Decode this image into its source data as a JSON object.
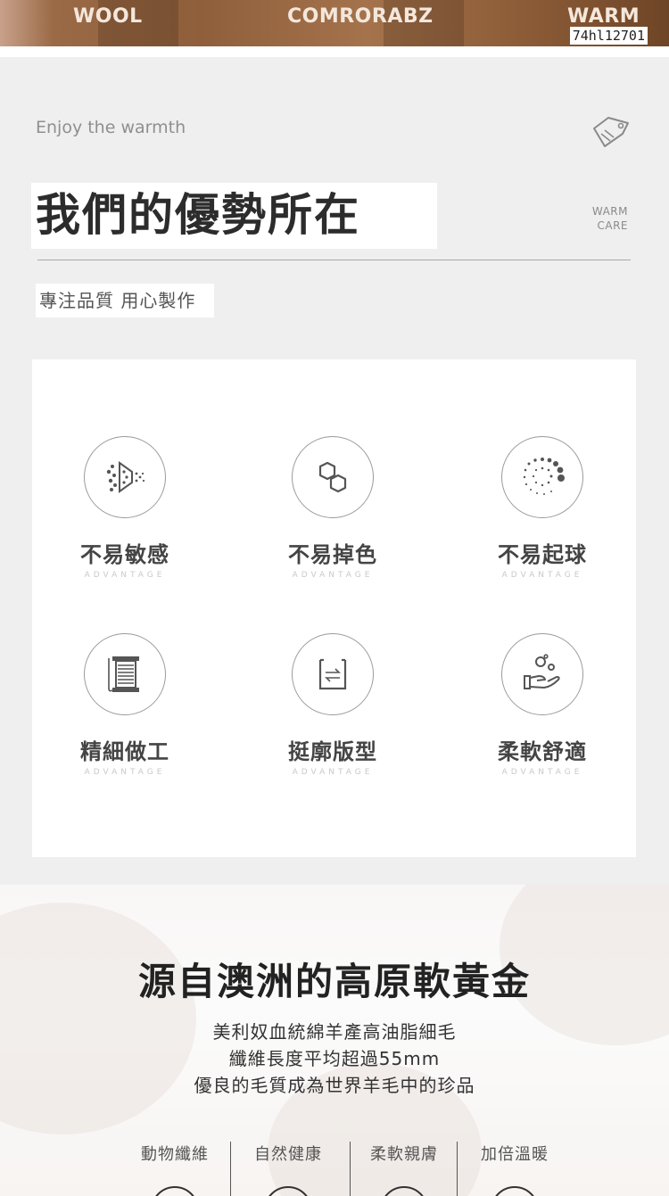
{
  "banner": {
    "words": [
      "WOOL",
      "COMRORABZ",
      "WARM"
    ],
    "sku": "74hl12701"
  },
  "header": {
    "tagline": "Enjoy the warmth",
    "title": "我們的優勢所在",
    "badge_line1": "WARM",
    "badge_line2": "CARE",
    "subtitle": "專注品質 用心製作"
  },
  "features": [
    {
      "label": "不易敏感",
      "en": "ADVANTAGE",
      "icon": "spray-particles-icon"
    },
    {
      "label": "不易掉色",
      "en": "ADVANTAGE",
      "icon": "hexagon-links-icon"
    },
    {
      "label": "不易起球",
      "en": "ADVANTAGE",
      "icon": "dots-ring-icon"
    },
    {
      "label": "精細做工",
      "en": "ADVANTAGE",
      "icon": "thread-spool-icon"
    },
    {
      "label": "挺廓版型",
      "en": "ADVANTAGE",
      "icon": "shape-arrows-icon"
    },
    {
      "label": "柔軟舒適",
      "en": "ADVANTAGE",
      "icon": "hand-bubbles-icon"
    }
  ],
  "origin": {
    "headline": "源自澳洲的高原軟黃金",
    "lines": [
      "美利奴血統綿羊產高油脂細毛",
      "纖維長度平均超過55mm",
      "優良的毛質成為世界羊毛中的珍品"
    ],
    "columns": [
      "動物纖維",
      "自然健康",
      "柔軟親膚",
      "加倍溫暖"
    ]
  },
  "colors": {
    "banner_brown": "#8f5f3c",
    "panel_bg": "#efefef",
    "card_bg": "#ffffff",
    "title_text": "#2c2c2c"
  }
}
